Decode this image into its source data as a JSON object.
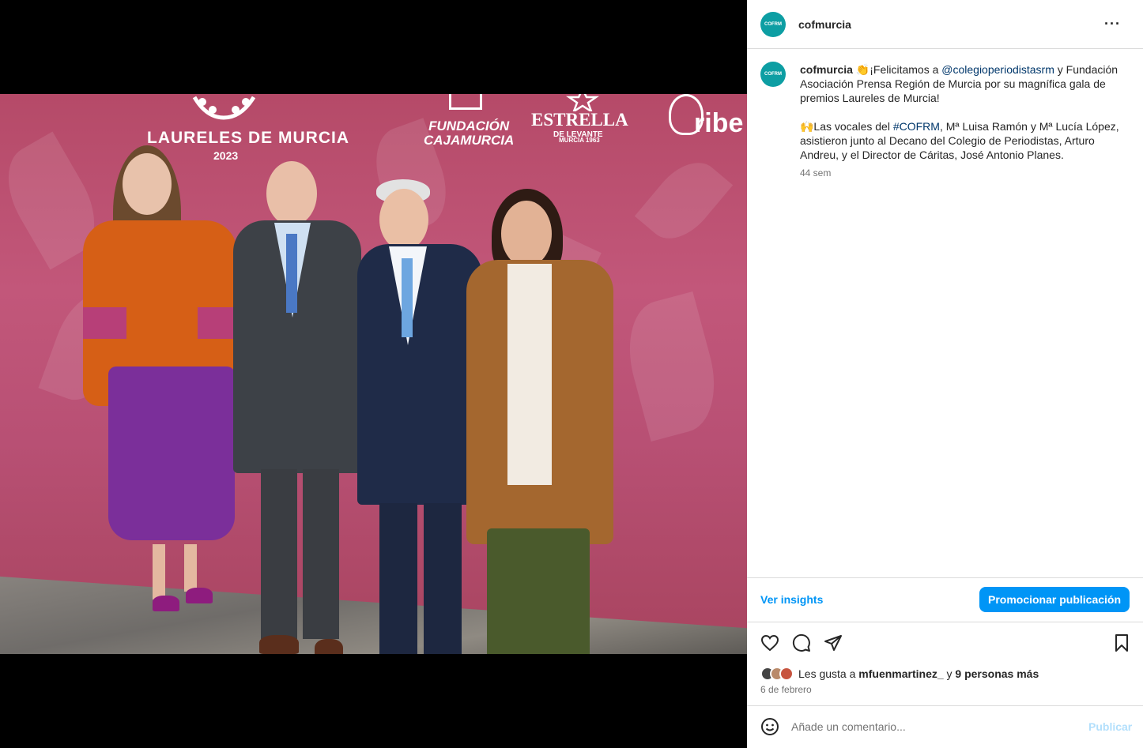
{
  "post": {
    "username": "cofmurcia",
    "avatar_text": "COFRM",
    "more_icon": "···"
  },
  "photo_banner": {
    "laureles": "LAURELES DE MURCIA",
    "laureles_year": "2023",
    "fundacion_line1": "FUNDACIÓN",
    "fundacion_line2": "CAJAMURCIA",
    "estrella": "ESTRELLA",
    "estrella_sub": "DE LEVANTE",
    "estrella_city": "MURCIA 1963",
    "ribe": "ribe"
  },
  "caption": {
    "username": "cofmurcia",
    "p1_a": " 👏¡Felicitamos a ",
    "mention": "@colegioperiodistasrm",
    "p1_b": " y Fundación Asociación Prensa Región de Murcia por su magnífica gala de premios Laureles de Murcia!",
    "p2_a": "🙌Las vocales del ",
    "hashtag": "#COFRM",
    "p2_b": ", Mª Luisa Ramón y Mª Lucía López, asistieron junto al Decano del Colegio de Periodistas, Arturo Andreu, y el Director de Cáritas, José Antonio Planes.",
    "time_ago": "44 sem"
  },
  "actions": {
    "insights_label": "Ver insights",
    "promote_label": "Promocionar publicación",
    "icons": [
      "heart-icon",
      "comment-icon",
      "share-icon",
      "bookmark-icon"
    ]
  },
  "likes": {
    "prefix": "Les gusta a ",
    "user": "mfuenmartinez_",
    "middle": " y ",
    "others": "9 personas más"
  },
  "date": "6 de febrero",
  "comment": {
    "placeholder": "Añade un comentario...",
    "publish_label": "Publicar"
  },
  "colors": {
    "accent": "#0095f6",
    "avatar": "#0d9ea3",
    "link": "#00376b",
    "backdrop": "#b54a68"
  }
}
